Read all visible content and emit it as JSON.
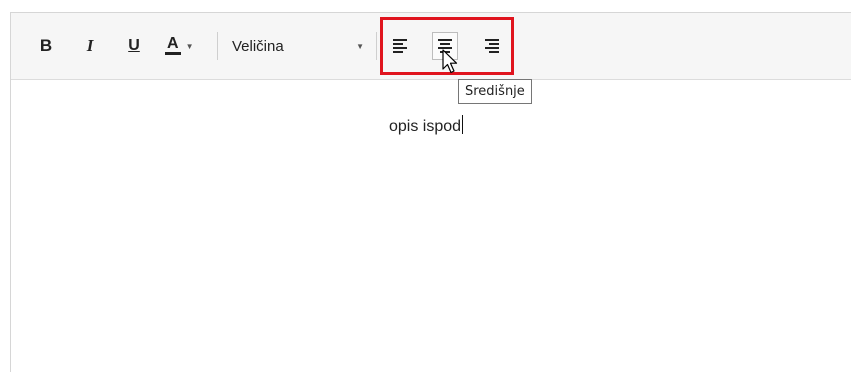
{
  "toolbar": {
    "bold_label": "B",
    "italic_label": "I",
    "underline_label": "U",
    "font_color_label": "A",
    "size_dropdown_value": "Veličina",
    "align_center_tooltip": "Središnje"
  },
  "editor": {
    "content_text": "opis ispod"
  },
  "colors": {
    "highlight": "#e0141e"
  },
  "icons": [
    "chevron-down-icon",
    "align-left-icon",
    "align-center-icon",
    "align-right-icon",
    "mouse-pointer-icon"
  ]
}
